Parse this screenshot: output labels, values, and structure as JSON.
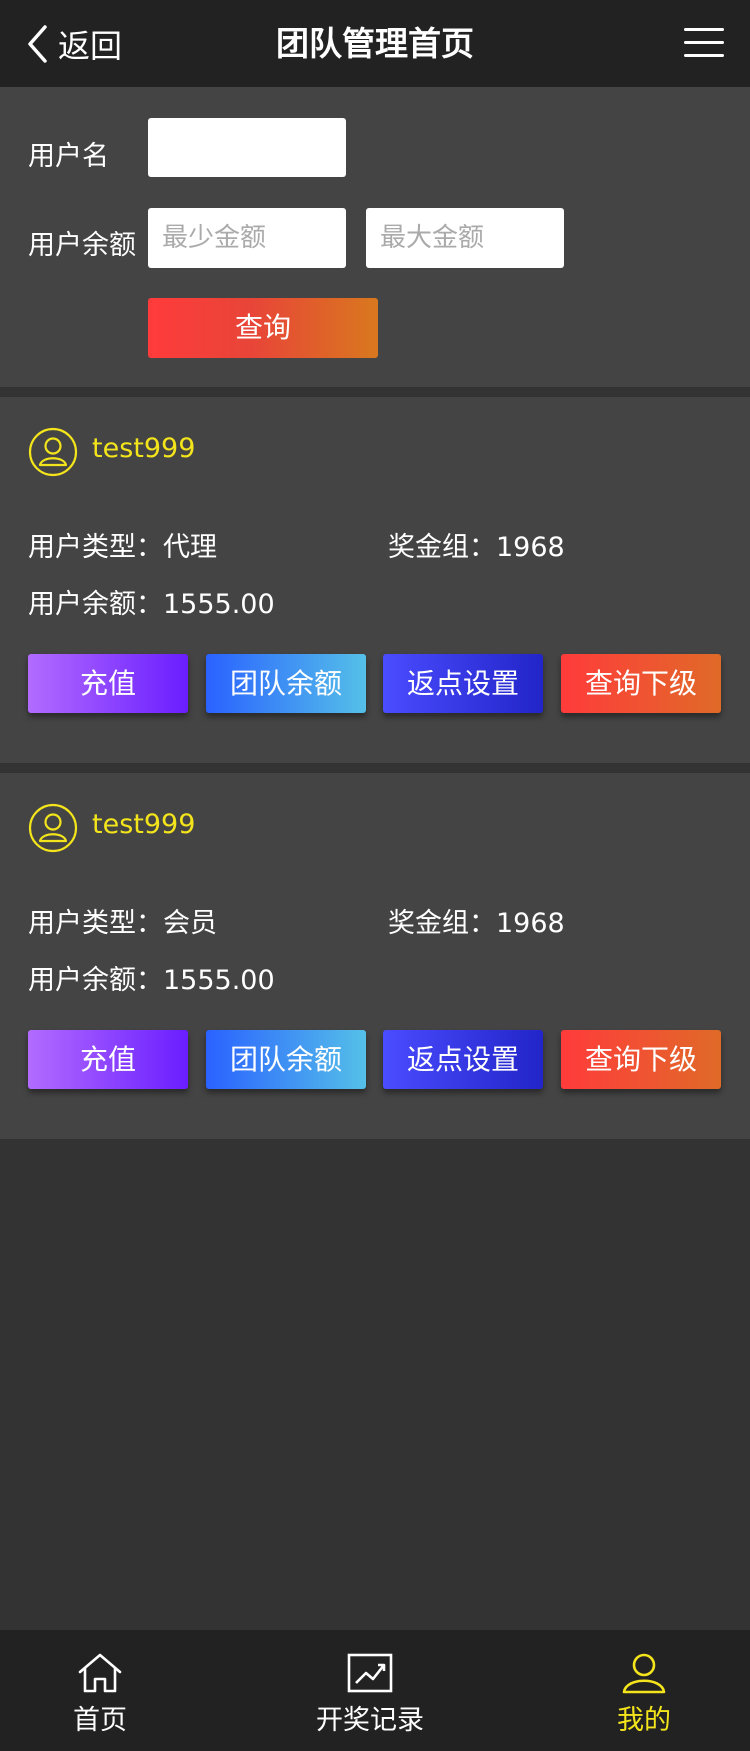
{
  "header": {
    "back_label": "返回",
    "title": "团队管理首页"
  },
  "search": {
    "username_label": "用户名",
    "username_value": "",
    "balance_label": "用户余额",
    "min_placeholder": "最少金额",
    "max_placeholder": "最大金额",
    "query_label": "查询"
  },
  "users": [
    {
      "name": "test999",
      "type_label": "用户类型：",
      "type": "代理",
      "bonus_label": "奖金组：",
      "bonus": "1968",
      "balance_label": "用户余额：",
      "balance": "1555.00"
    },
    {
      "name": "test999",
      "type_label": "用户类型：",
      "type": "会员",
      "bonus_label": "奖金组：",
      "bonus": "1968",
      "balance_label": "用户余额：",
      "balance": "1555.00"
    }
  ],
  "actions": {
    "recharge": "充值",
    "team_balance": "团队余额",
    "rebate": "返点设置",
    "subordinates": "查询下级"
  },
  "tabs": [
    {
      "label": "首页",
      "icon": "home-icon"
    },
    {
      "label": "开奖记录",
      "icon": "chart-icon"
    },
    {
      "label": "我的",
      "icon": "user-icon",
      "active": true
    }
  ],
  "colors": {
    "accent": "#f3e41c",
    "header_bg": "#222222",
    "panel_bg": "#444444",
    "page_bg": "#333333"
  }
}
